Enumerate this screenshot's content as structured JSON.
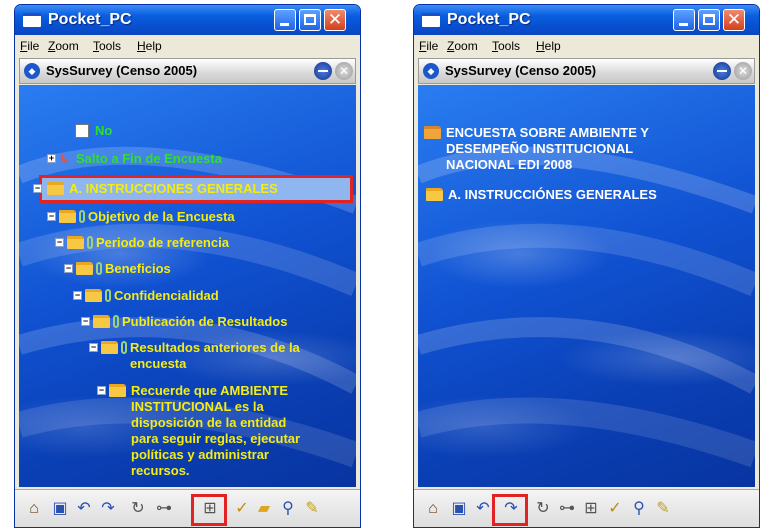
{
  "left": {
    "title": "Pocket_PC",
    "menu": [
      "File",
      "Zoom",
      "Tools",
      "Help"
    ],
    "app_title": "SysSurvey  (Censo 2005)",
    "tree": {
      "no": "No",
      "salto": "Salto a Fin de Encuesta",
      "instrucciones": "A. INSTRUCCIONES GENERALES",
      "objetivo": "Objetivo de la Encuesta",
      "periodo": "Periodo de referencia",
      "beneficios": "Beneficios",
      "confidencialidad": "Confidencialidad",
      "publicacion": "Publicación de Resultados",
      "resultados_1": "Resultados anteriores de la",
      "resultados_2": "encuesta",
      "recuerde_1": "Recuerde que  AMBIENTE",
      "recuerde_2": "INSTITUCIONAL es la",
      "recuerde_3": "disposición de la entidad",
      "recuerde_4": "para seguir reglas, ejecutar",
      "recuerde_5": "políticas y administrar",
      "recuerde_6": "recursos."
    }
  },
  "right": {
    "title": "Pocket_PC",
    "menu": [
      "File",
      "Zoom",
      "Tools",
      "Help"
    ],
    "app_title": "SysSurvey  (Censo 2005)",
    "tree": {
      "encuesta_1": "ENCUESTA SOBRE AMBIENTE Y",
      "encuesta_2": "DESEMPEÑO INSTITUCIONAL",
      "encuesta_3": "NACIONAL EDI 2008",
      "instrucciones": "A. INSTRUCCIÓNES GENERALES"
    }
  },
  "colors": {
    "titlebar": "#0a5fe0",
    "tree_yellow": "#f4ec12",
    "tree_green": "#2ee02e",
    "highlight_frame": "#e32322"
  },
  "toolbar_icons": [
    "home-icon",
    "save-icon",
    "undo-icon",
    "redo-icon",
    "refresh-icon",
    "tree-icon",
    "expand-icon",
    "check-icon",
    "folder-icon",
    "search-icon",
    "edit-icon"
  ]
}
